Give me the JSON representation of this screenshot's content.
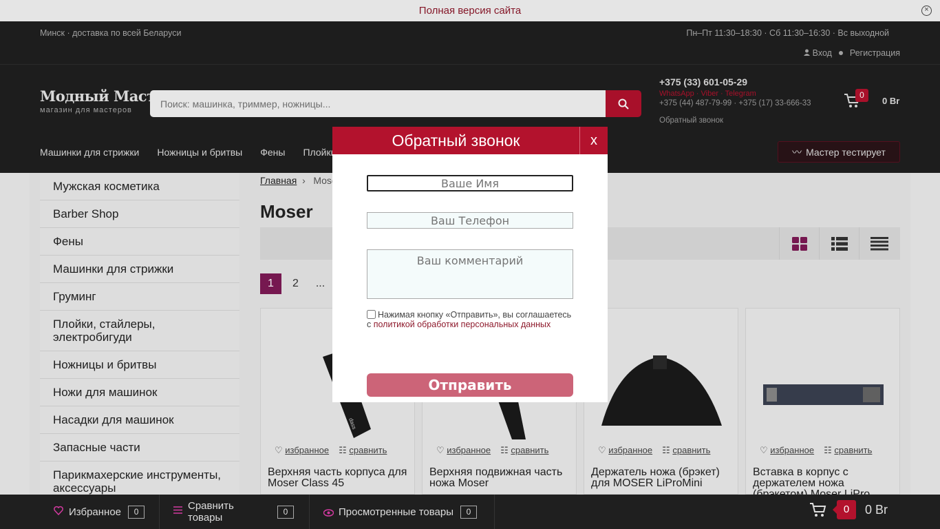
{
  "topbar": {
    "full_version": "Полная версия сайта"
  },
  "header": {
    "location": "Минск · доставка по всей Беларуси",
    "hours": "Пн–Пт 11:30–18:30 · Сб 11:30–16:30 · Вс выходной",
    "login": "Вход",
    "register": "Регистрация",
    "logo_main": "Модный Мастер",
    "logo_sub": "магазин для мастеров",
    "search_placeholder": "Поиск: машинка, триммер, ножницы...",
    "phone_main": "+375 (33) 601-05-29",
    "messengers": "WhatsApp · Viber · Telegram",
    "phones_extra": "+375 (44) 487-79-99 · +375 (17) 33-666-33",
    "callback": "Обратный звонок",
    "cart_count": "0",
    "cart_sum": "0 Br",
    "nav": [
      "Машинки для стрижки",
      "Ножницы и бритвы",
      "Фены",
      "Плойки"
    ],
    "master_button": "Мастер тестирует"
  },
  "sidebar": {
    "items": [
      "Мужская косметика",
      "Barber Shop",
      "Фены",
      "Машинки для стрижки",
      "Груминг",
      "Плойки, стайлеры, электробигуди",
      "Ножницы и бритвы",
      "Ножи для машинок",
      "Насадки для машинок",
      "Запасные части",
      "Парикмахерские инструменты, аксессуары"
    ]
  },
  "main": {
    "breadcrumb_home": "Главная",
    "breadcrumb_current": "Moser",
    "title": "Moser",
    "pages": [
      "1",
      "2",
      "..."
    ],
    "favorite_label": "избранное",
    "compare_label": "сравнить",
    "products": [
      "Верхняя часть корпуса для Moser Class 45",
      "Верхняя подвижная часть ножа Moser",
      "Держатель ножа (брэкет) для MOSER LiProMini",
      "Вставка в корпус с держателем ножа (брэкетом) Moser LiPro"
    ]
  },
  "modal": {
    "title": "Обратный звонок",
    "close": "x",
    "name_placeholder": "Ваше Имя",
    "phone_placeholder": "Ваш Телефон",
    "comment_placeholder": "Ваш комментарий",
    "consent_text": "Нажимая кнопку «Отправить», вы соглашаетесь с ",
    "consent_link": "политикой обработки персональных данных",
    "submit": "Отправить"
  },
  "bottombar": {
    "favorites": "Избранное",
    "favorites_count": "0",
    "compare": "Сравнить товары",
    "compare_count": "0",
    "viewed": "Просмотренные товары",
    "viewed_count": "0",
    "cart_count": "0",
    "cart_sum": "0 Br"
  },
  "colors": {
    "accent": "#b3122d",
    "header_bg": "#1f1f1f",
    "pager_active": "#7e1a55"
  }
}
